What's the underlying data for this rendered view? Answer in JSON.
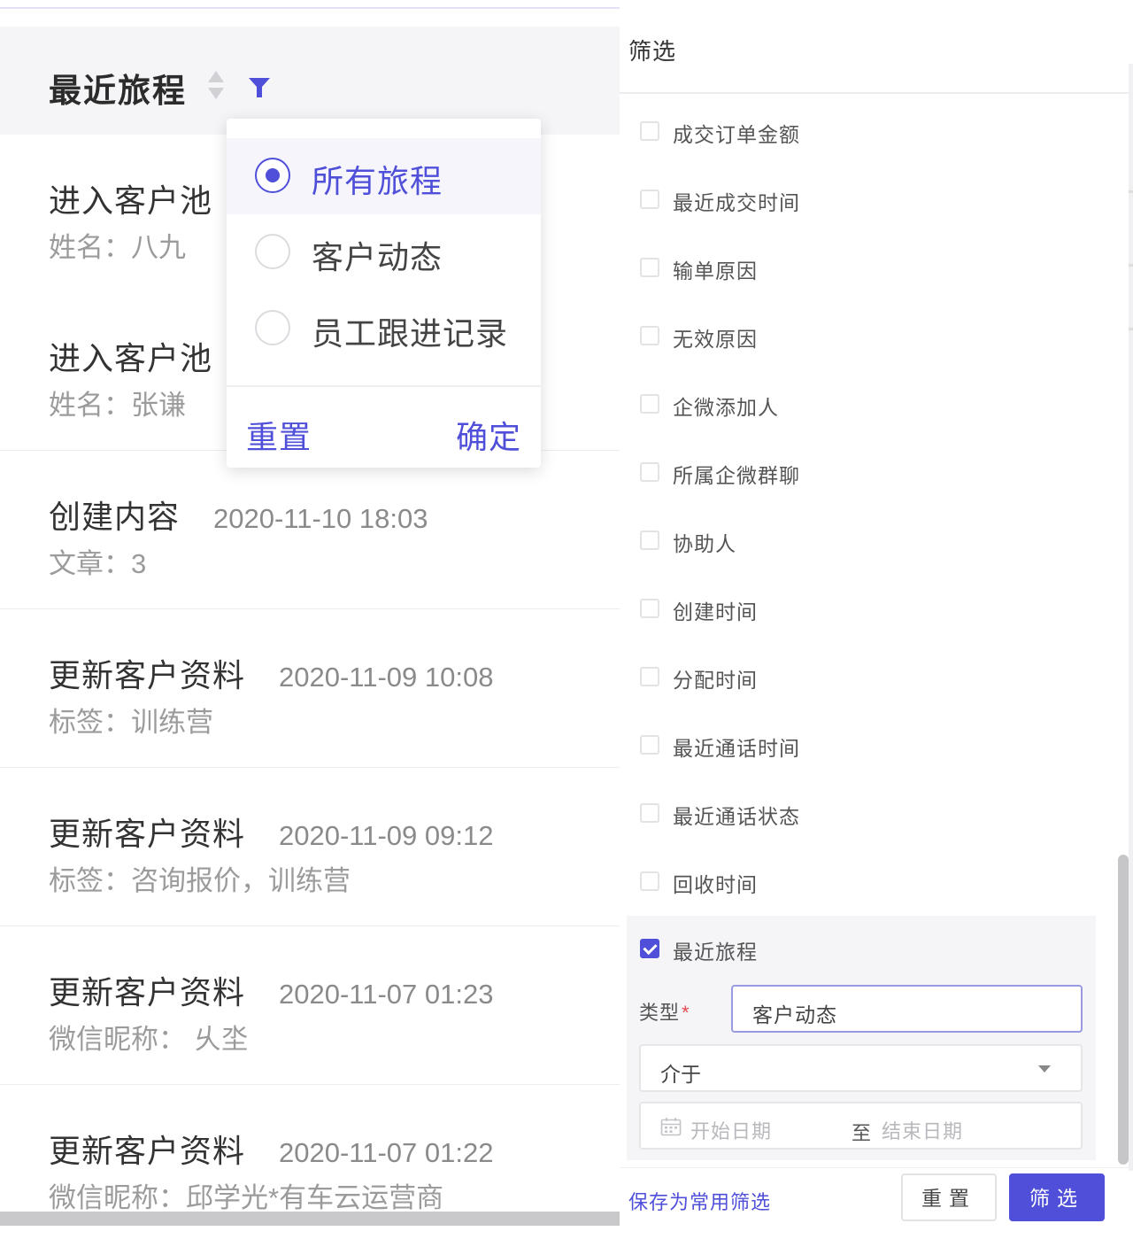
{
  "journey_list": {
    "header_title": "最近旅程",
    "items": [
      {
        "title": "进入客户池",
        "time": "",
        "detail": "姓名：八九"
      },
      {
        "title": "进入客户池",
        "time": "",
        "detail": "姓名：张谦"
      },
      {
        "title": "创建内容",
        "time": "2020-11-10 18:03",
        "detail": "文章：3"
      },
      {
        "title": "更新客户资料",
        "time": "2020-11-09 10:08",
        "detail": "标签：训练营"
      },
      {
        "title": "更新客户资料",
        "time": "2020-11-09 09:12",
        "detail": "标签：咨询报价，训练营"
      },
      {
        "title": "更新客户资料",
        "time": "2020-11-07 01:23",
        "detail": "微信昵称：   乆坔"
      },
      {
        "title": "更新客户资料",
        "time": "2020-11-07 01:22",
        "detail": "微信昵称：邱学光*有车云运营商"
      }
    ]
  },
  "popup": {
    "options": [
      "所有旅程",
      "客户动态",
      "员工跟进记录"
    ],
    "selected_option": "所有旅程",
    "reset_label": "重置",
    "confirm_label": "确定"
  },
  "filter_drawer": {
    "title": "筛选",
    "fields": [
      {
        "label": "成交订单金额",
        "checked": false
      },
      {
        "label": "最近成交时间",
        "checked": false
      },
      {
        "label": "输单原因",
        "checked": false
      },
      {
        "label": "无效原因",
        "checked": false
      },
      {
        "label": "企微添加人",
        "checked": false
      },
      {
        "label": "所属企微群聊",
        "checked": false
      },
      {
        "label": "协助人",
        "checked": false
      },
      {
        "label": "创建时间",
        "checked": false
      },
      {
        "label": "分配时间",
        "checked": false
      },
      {
        "label": "最近通话时间",
        "checked": false
      },
      {
        "label": "最近通话状态",
        "checked": false
      },
      {
        "label": "回收时间",
        "checked": false
      },
      {
        "label": "最近旅程",
        "checked": true
      }
    ],
    "expanded": {
      "type_label": "类型",
      "required_mark": "*",
      "type_value": "客户动态",
      "operator_value": "介于",
      "start_placeholder": "开始日期",
      "range_separator": "至",
      "end_placeholder": "结束日期"
    },
    "save_link": "保存为常用筛选",
    "reset_button": "重置",
    "submit_button": "筛选"
  },
  "colors": {
    "accent": "#4f4fd9",
    "required": "#e5484d",
    "muted_text": "#9b9b9b"
  }
}
